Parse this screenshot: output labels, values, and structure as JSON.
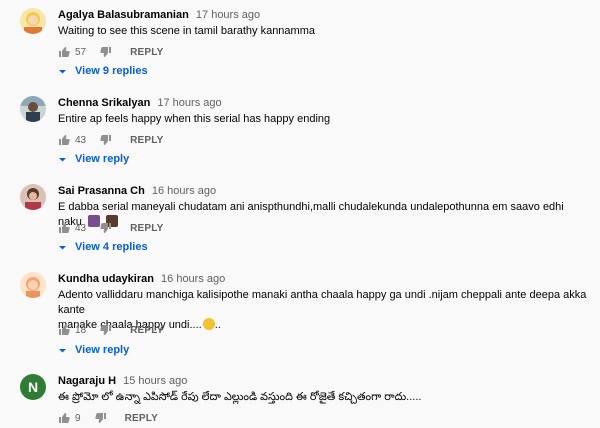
{
  "comments": [
    {
      "author": "Agalya Balasubramanian",
      "time": "17 hours ago",
      "text": "Waiting to see this scene in tamil barathy  kannamma",
      "likes": "57",
      "reply_label": "REPLY",
      "replies_label": "View 9 replies",
      "avatar_color": "#f2c94c"
    },
    {
      "author": "Chenna Srikalyan",
      "time": "17 hours ago",
      "text": "Entire ap feels happy when this serial has happy ending",
      "likes": "43",
      "reply_label": "REPLY",
      "replies_label": "View reply",
      "avatar_color": "#6b8e9e"
    },
    {
      "author": "Sai Prasanna Ch",
      "time": "16 hours ago",
      "text": "E dabba serial maneyali chudatam ani anispthundhi,malli chudalekunda undalepothunna em saavo edhi naku",
      "likes": "43",
      "reply_label": "REPLY",
      "replies_label": "View 4 replies",
      "avatar_color": "#b07a6a"
    },
    {
      "author": "Kundha udaykiran",
      "time": "16 hours ago",
      "text_line1": "Adento valliddaru manchiga kalisipothe manaki antha chaala happy ga undi .nijam cheppali ante deepa akka kante",
      "text_line2": "manake chaala happy undi....",
      "text_line2_suffix": "..",
      "likes": "18",
      "reply_label": "REPLY",
      "replies_label": "View reply",
      "avatar_color": "#f4a37a"
    },
    {
      "author": "Nagaraju H",
      "time": "15 hours ago",
      "avatar_letter": "N",
      "text": "ఈ ప్రోమో లో ఉన్నా ఎపిసోడ్ రేపు లేదా ఎల్లుండి వస్తుంది ఈ రోజైతే కచ్చితంగా రాదు.....",
      "likes": "9",
      "reply_label": "REPLY",
      "avatar_color": "#2e7d32"
    }
  ],
  "colors": {
    "link_blue": "#065fd4",
    "meta_gray": "#606060",
    "background": "#f9f9f9"
  },
  "icons": [
    "like-icon",
    "dislike-icon",
    "chevron-down-icon",
    "emoji-icon"
  ]
}
